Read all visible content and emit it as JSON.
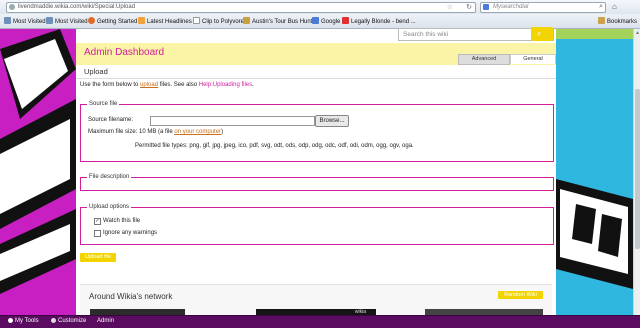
{
  "browser": {
    "url": "livendmaddie.wikia.com/wiki/Special:Upload",
    "search_text": "Mysearchdial",
    "bookmarks": [
      {
        "label": "Most Visited",
        "color": "#6d8fb8"
      },
      {
        "label": "Most Visited",
        "color": "#6d8fb8"
      },
      {
        "label": "Getting Started",
        "color": "#e06a2a"
      },
      {
        "label": "Latest Headlines",
        "color": "#f2a43a"
      },
      {
        "label": "Clip to Polyvore",
        "color": "#ffffff"
      },
      {
        "label": "Austin's Tour Bus Hunt",
        "color": "#c8a040"
      },
      {
        "label": "Google",
        "color": "#4a7bd8"
      },
      {
        "label": "Legally Blonde - bend ...",
        "color": "#e03030"
      }
    ],
    "bookmarks_menu": "Bookmarks"
  },
  "site_search": {
    "placeholder": "Search this wiki"
  },
  "admin": {
    "title": "Admin Dashboard",
    "tabs": [
      "Advanced",
      "General"
    ]
  },
  "upload": {
    "heading": "Upload",
    "intro_prefix": "Use the form below to ",
    "intro_link": "upload",
    "intro_mid": " files. See also ",
    "intro_help": "Help:Uploading files",
    "intro_suffix": ".",
    "source_legend": "Source file",
    "source_label": "Source filename:",
    "browse_label": "Browse...",
    "max_size": "Maximum file size: 10 MB (a file ",
    "max_size_link": "on your computer",
    "max_size_end": ")",
    "permitted": "Permitted file types: png, gif, jpg, jpeg, ico, pdf, svg, odt, ods, odp, odg, odc, odf, odi, odm, ogg, ogv, oga.",
    "desc_legend": "File description",
    "options_legend": "Upload options",
    "watch_label": "Watch this file",
    "watch_checked": true,
    "ignore_label": "Ignore any warnings",
    "ignore_checked": false,
    "upload_button": "Upload file"
  },
  "network": {
    "title": "Around Wikia's network",
    "random_button": "Random Wiki",
    "thumb_text": "wikia"
  },
  "toolbar": {
    "my_tools": "My Tools",
    "customize": "Customize",
    "admin": "Admin"
  }
}
